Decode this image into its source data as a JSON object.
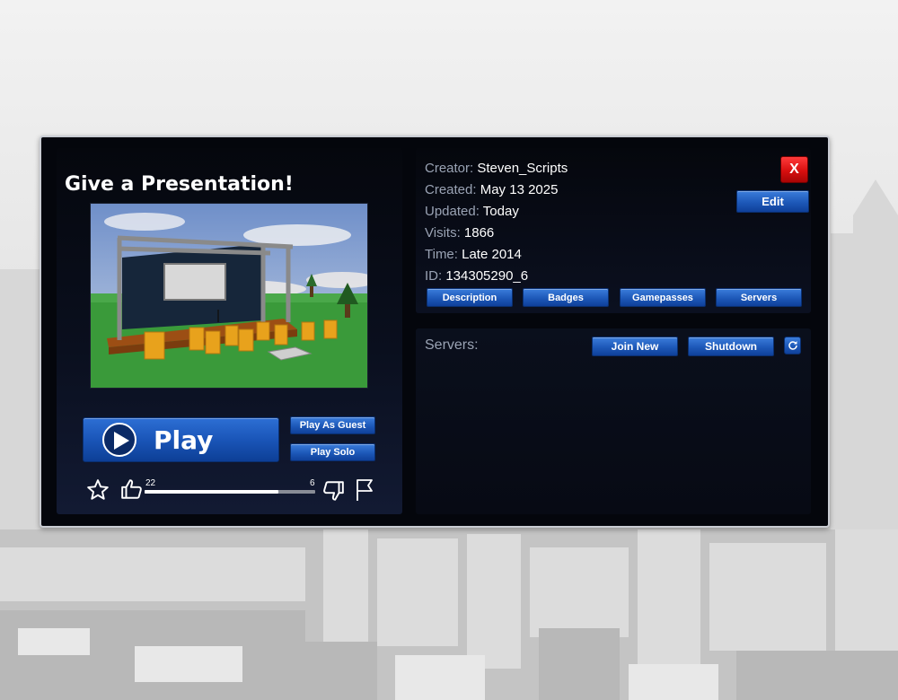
{
  "game": {
    "title": "Give a Presentation!"
  },
  "actions": {
    "play_label": "Play",
    "play_as_guest_label": "Play As Guest",
    "play_solo_label": "Play Solo"
  },
  "rating": {
    "likes": "22",
    "dislikes": "6",
    "like_fraction": 0.786
  },
  "info": {
    "rows": [
      {
        "key": "Creator:",
        "value": "Steven_Scripts"
      },
      {
        "key": "Created:",
        "value": "May 13 2025"
      },
      {
        "key": "Updated:",
        "value": "Today"
      },
      {
        "key": "Visits:",
        "value": "1866"
      },
      {
        "key": "Time:",
        "value": "Late 2014"
      },
      {
        "key": "ID:",
        "value": "134305290_6"
      }
    ],
    "close_label": "X",
    "edit_label": "Edit",
    "tabs": [
      {
        "label": "Description"
      },
      {
        "label": "Badges"
      },
      {
        "label": "Gamepasses"
      },
      {
        "label": "Servers"
      }
    ]
  },
  "servers": {
    "label": "Servers:",
    "join_new_label": "Join New",
    "shutdown_label": "Shutdown"
  },
  "icons": {
    "play": "play-icon",
    "favorite": "star-icon",
    "like": "thumbs-up-icon",
    "dislike": "thumbs-down-icon",
    "report": "flag-icon",
    "refresh": "refresh-icon"
  }
}
